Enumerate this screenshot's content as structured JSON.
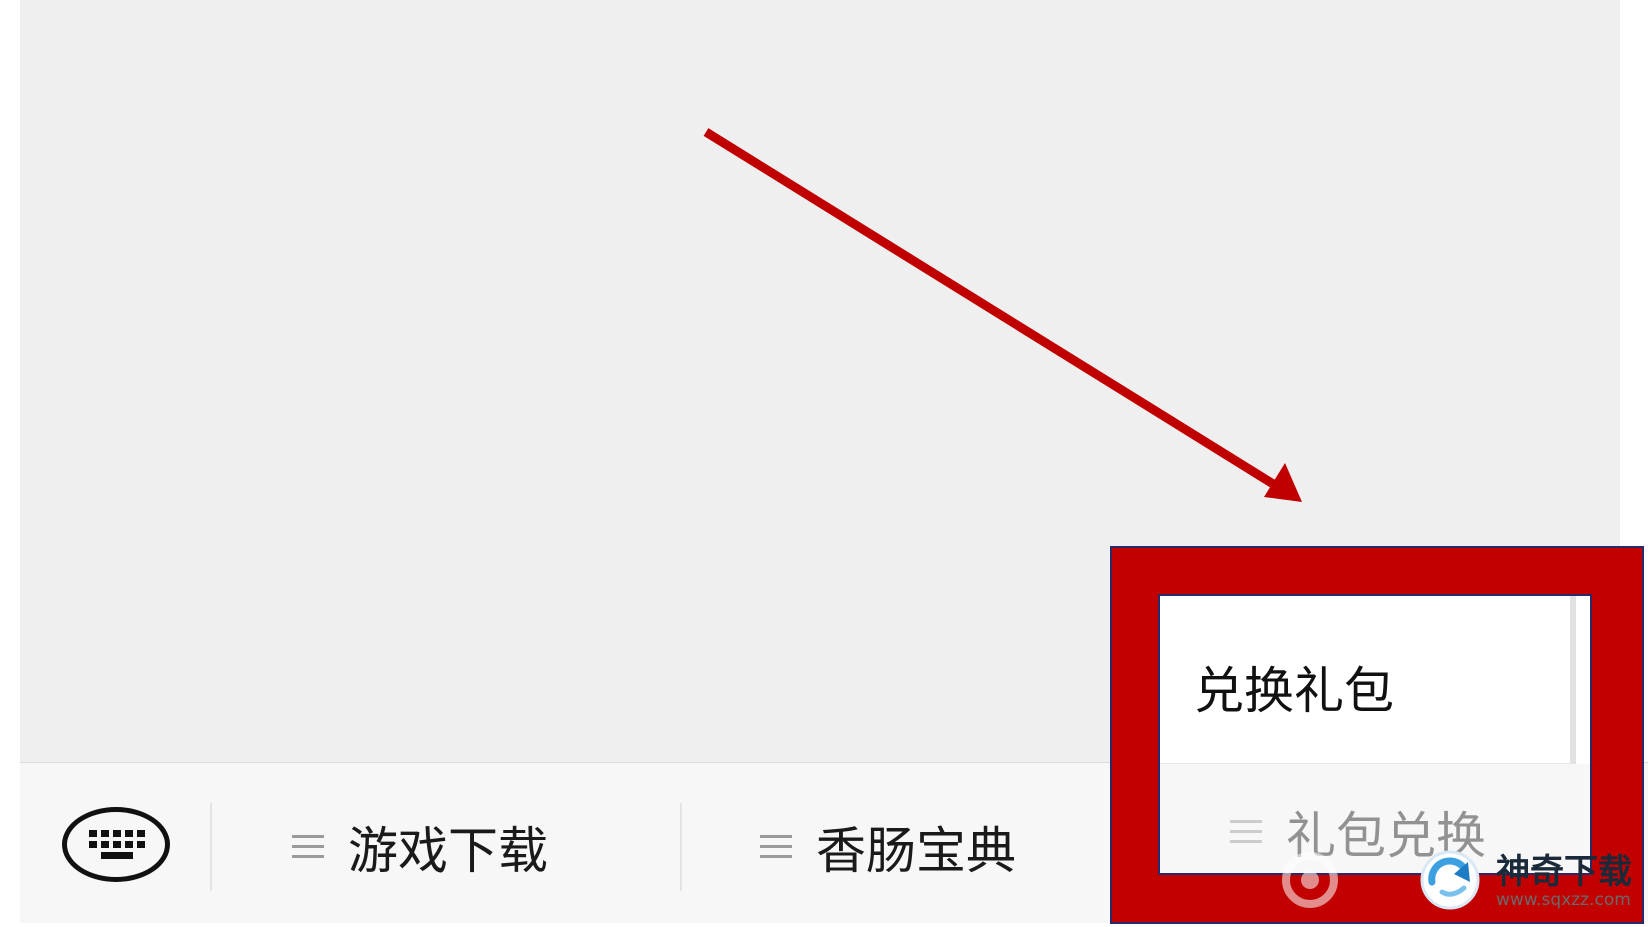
{
  "bottom_menu": {
    "keyboard_button": {
      "icon": "keyboard-icon"
    },
    "items": [
      {
        "label": "游戏下载",
        "icon": "menu-lines-icon"
      },
      {
        "label": "香肠宝典",
        "icon": "menu-lines-icon"
      },
      {
        "label": "礼包兑换",
        "icon": "menu-lines-icon"
      }
    ]
  },
  "popup_menu": {
    "items": [
      {
        "label": "兑换礼包"
      }
    ]
  },
  "annotation": {
    "arrow_color": "#c00000",
    "highlight_color": "#c20000"
  },
  "watermark": {
    "title": "神奇下载",
    "url": "www.sqxzz.com"
  }
}
